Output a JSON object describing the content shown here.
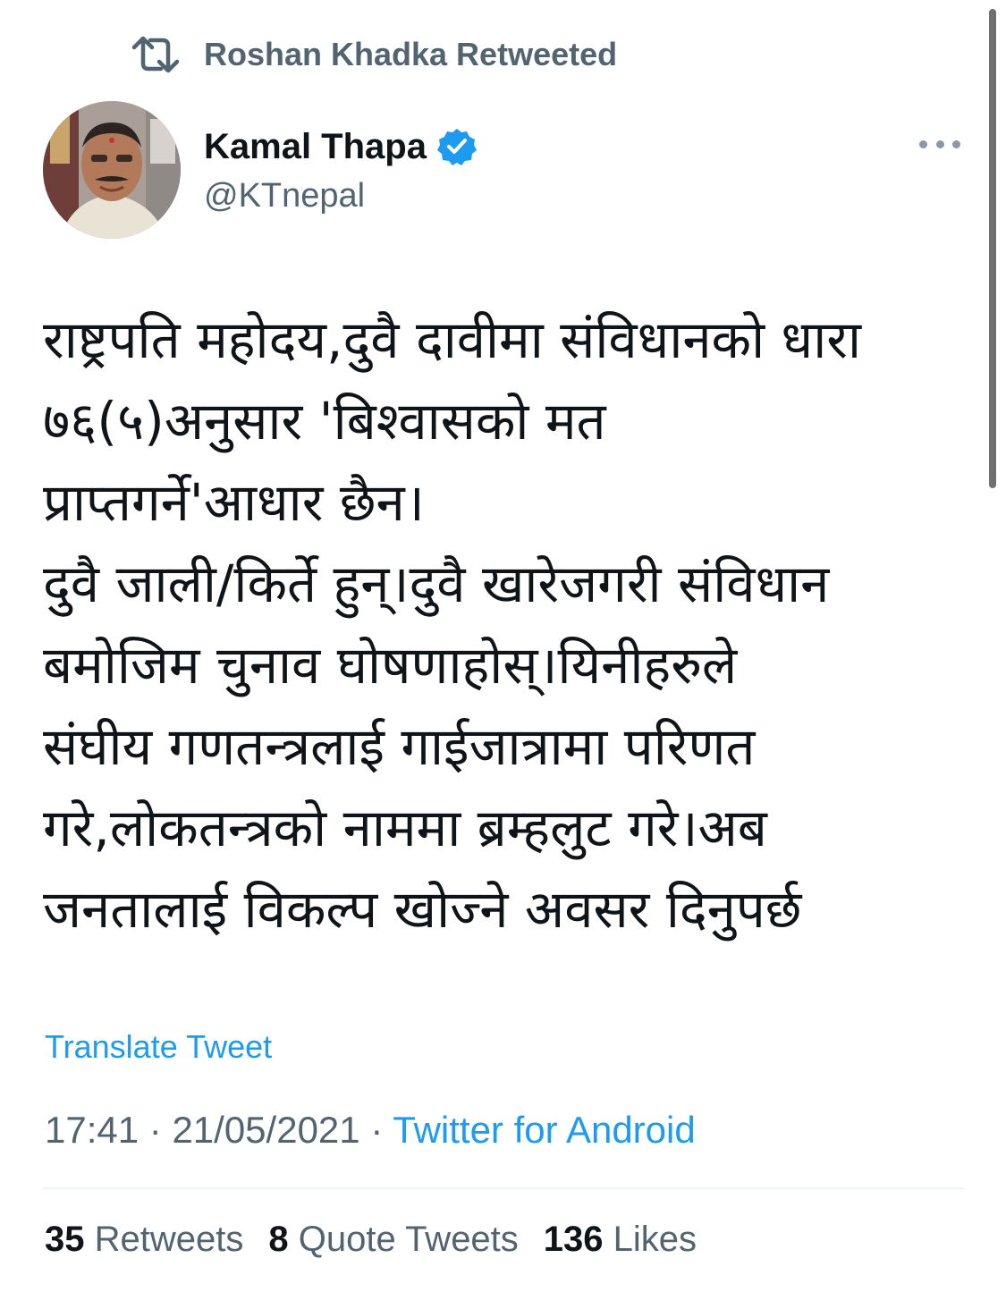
{
  "retweet_banner": {
    "text": "Roshan Khadka Retweeted",
    "icon": "retweet-icon"
  },
  "author": {
    "name": "Kamal Thapa",
    "handle": "@KTnepal",
    "verified": true,
    "avatar": "avatar-photo",
    "verified_icon": "verified-badge-icon"
  },
  "more_icon": "more-options-icon",
  "tweet": {
    "lines": [
      "राष्ट्रपति महोदय,दुवै दावीमा संविधानको धारा",
      "७६(५)अनुसार 'बिश्वासको मत",
      "प्राप्तगर्ने'आधार छैन।",
      "दुवै जाली/किर्ते हुन्।दुवै खारेजगरी संविधान",
      "बमोजिम चुनाव घोषणाहोस्।यिनीहरुले",
      "संघीय गणतन्त्रलाई गाईजात्रामा परिणत",
      "गरे,लोकतन्त्रको नाममा ब्रम्हलुट गरे।अब",
      "जनतालाई विकल्प खोज्ने अवसर दिनुपर्छ"
    ]
  },
  "translate_label": "Translate Tweet",
  "meta": {
    "time": "17:41",
    "separator": "·",
    "date": "21/05/2021",
    "source": "Twitter for Android"
  },
  "stats": {
    "retweets_count": "35",
    "retweets_label": "Retweets",
    "quotes_count": "8",
    "quotes_label": "Quote Tweets",
    "likes_count": "136",
    "likes_label": "Likes"
  },
  "colors": {
    "accent": "#1d9bf0",
    "secondary_text": "#536471",
    "primary_text": "#0f1419"
  }
}
